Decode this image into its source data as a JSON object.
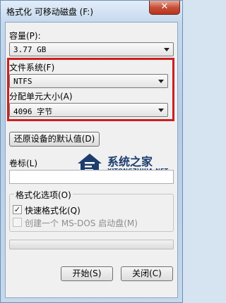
{
  "window": {
    "title": "格式化 可移动磁盘 (F:)",
    "close_glyph": "✕"
  },
  "capacity": {
    "label": "容量(P):",
    "value": "3.77 GB"
  },
  "filesystem": {
    "label": "文件系统(F)",
    "value": "NTFS"
  },
  "allocation": {
    "label": "分配单元大小(A)",
    "value": "4096 字节"
  },
  "restore_defaults_label": "还原设备的默认值(D)",
  "volume_label": {
    "label": "卷标(L)",
    "value": ""
  },
  "format_options": {
    "title": "格式化选项(O)",
    "quick_format": {
      "label": "快速格式化(Q)",
      "checked": true
    },
    "msdos_disk": {
      "label": "创建一个 MS-DOS 启动盘(M)",
      "checked": false,
      "enabled": false
    }
  },
  "progress": {
    "fraction": 0
  },
  "buttons": {
    "start": "开始(S)",
    "close": "关闭(C)"
  },
  "watermark": {
    "name": "系统之家",
    "url": "XITONGZHIJIA.NET"
  },
  "colors": {
    "highlight_border": "#cc1f1f",
    "close_button": "#c7503a"
  }
}
